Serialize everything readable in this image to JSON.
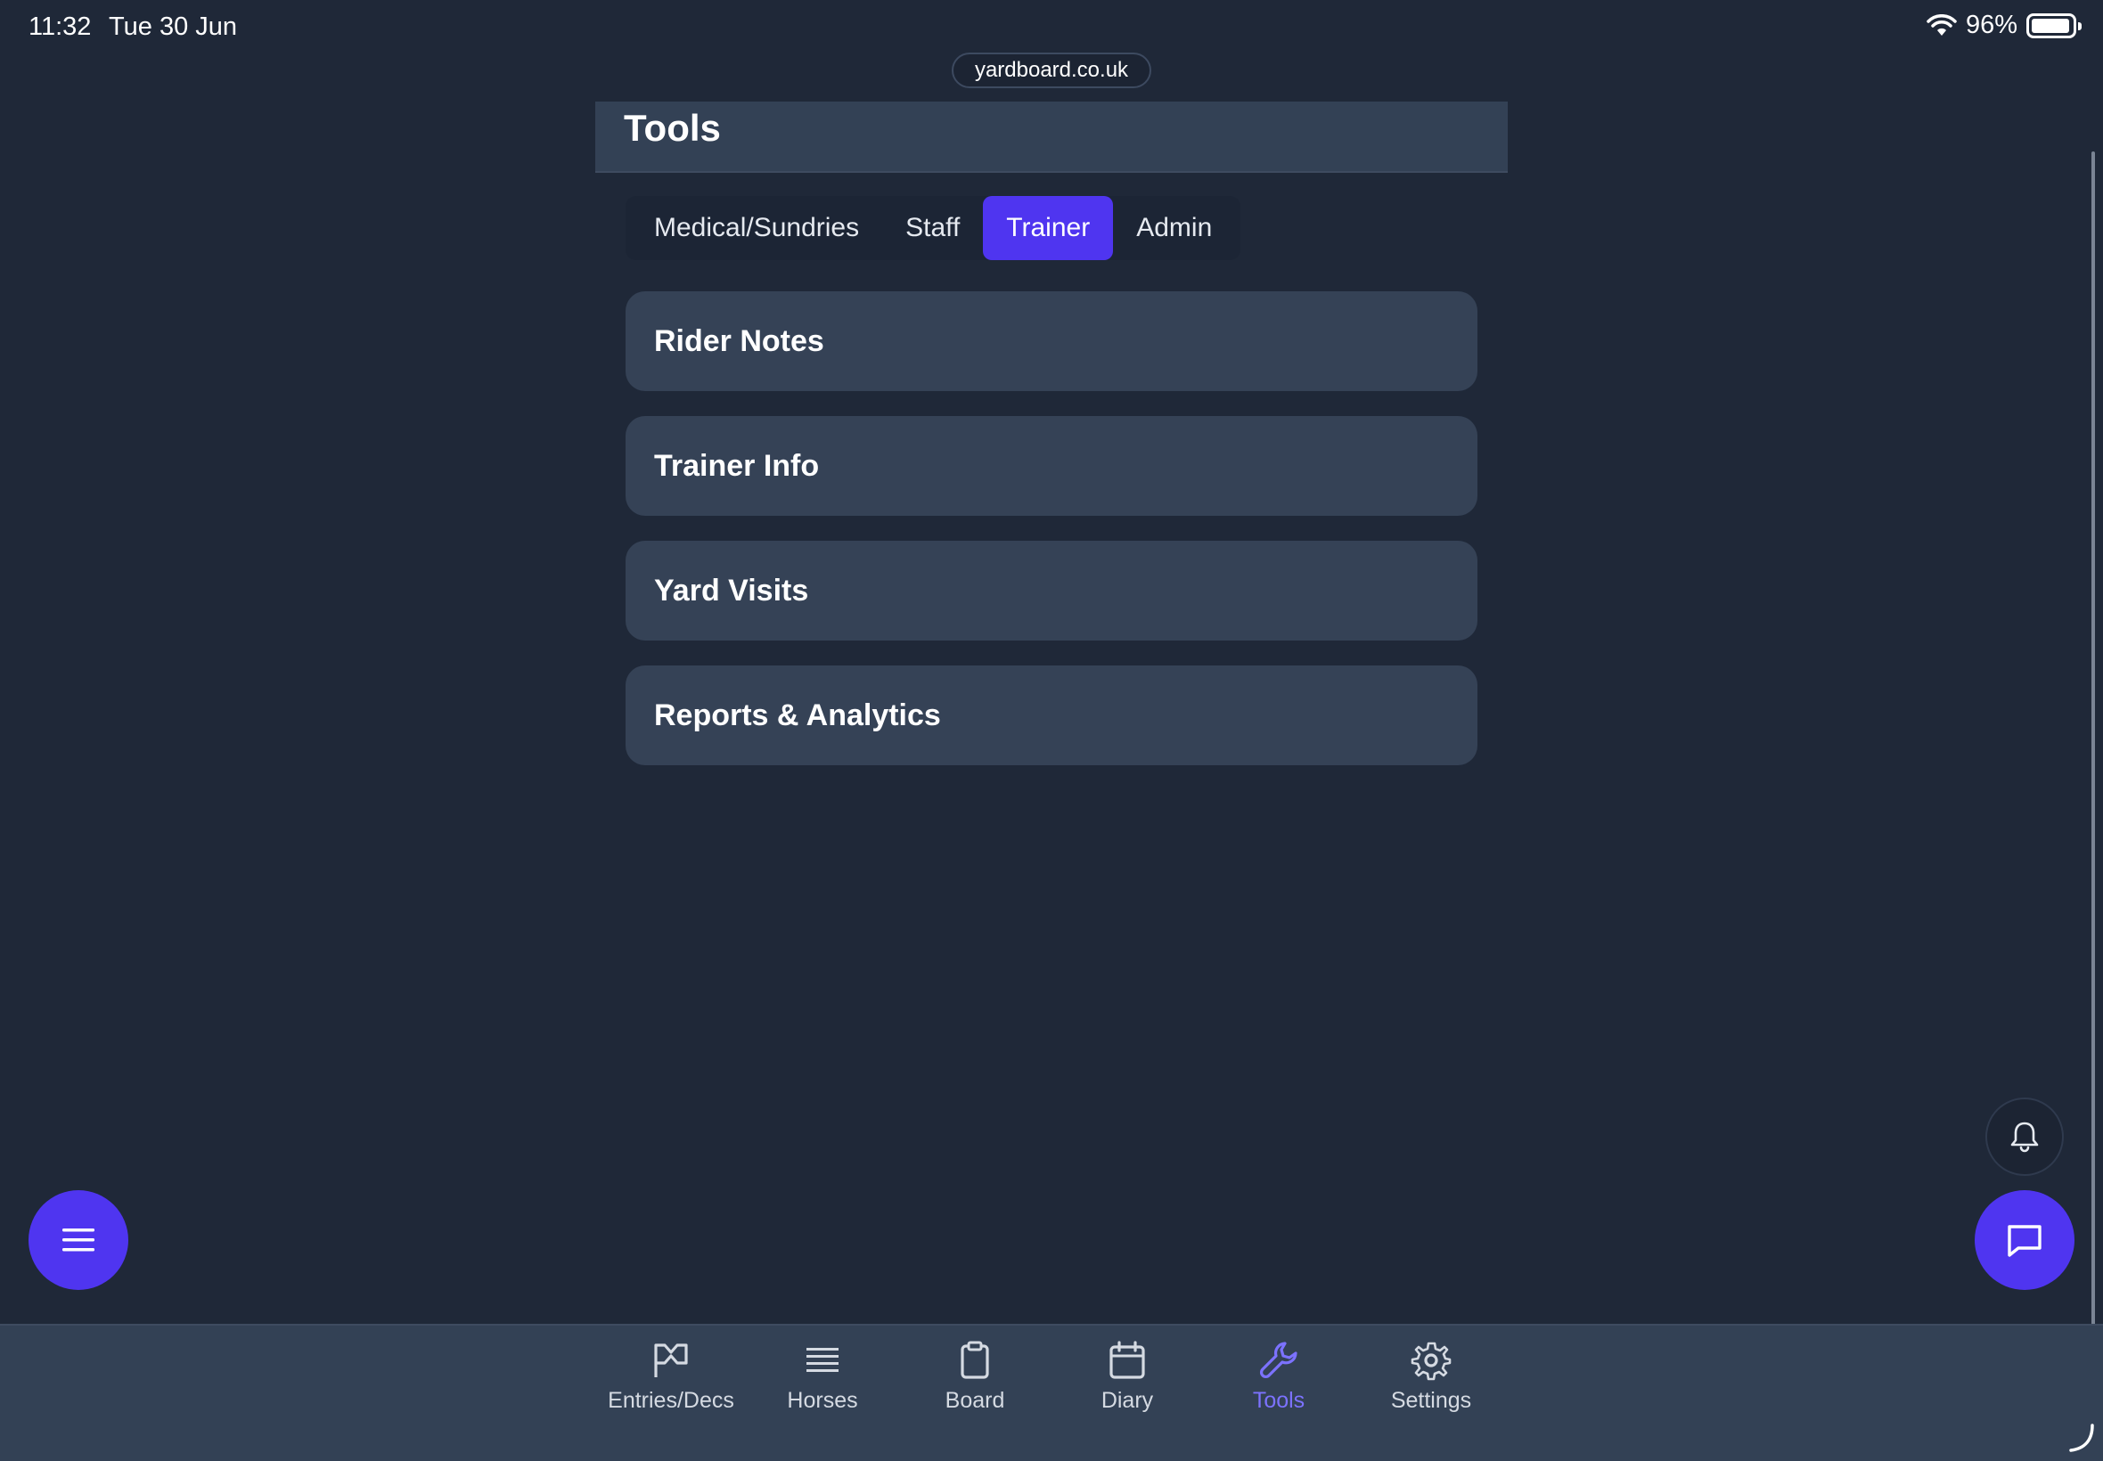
{
  "status_bar": {
    "time": "11:32",
    "date": "Tue 30 Jun",
    "battery": "96%"
  },
  "browser": {
    "url": "yardboard.co.uk"
  },
  "page": {
    "title": "Tools"
  },
  "tabs": [
    {
      "label": "Medical/Sundries",
      "active": false
    },
    {
      "label": "Staff",
      "active": false
    },
    {
      "label": "Trainer",
      "active": true
    },
    {
      "label": "Admin",
      "active": false
    }
  ],
  "cards": [
    {
      "label": "Rider Notes"
    },
    {
      "label": "Trainer Info"
    },
    {
      "label": "Yard Visits"
    },
    {
      "label": "Reports & Analytics"
    }
  ],
  "bottom_nav": [
    {
      "label": "Entries/Decs",
      "icon": "flag-icon",
      "active": false
    },
    {
      "label": "Horses",
      "icon": "list-icon",
      "active": false
    },
    {
      "label": "Board",
      "icon": "clipboard-icon",
      "active": false
    },
    {
      "label": "Diary",
      "icon": "calendar-icon",
      "active": false
    },
    {
      "label": "Tools",
      "icon": "wrench-icon",
      "active": true
    },
    {
      "label": "Settings",
      "icon": "gear-icon",
      "active": false
    }
  ],
  "colors": {
    "background": "#1f2838",
    "surface": "#354256",
    "accent": "#4f35f0",
    "active_nav": "#7c72ff"
  }
}
